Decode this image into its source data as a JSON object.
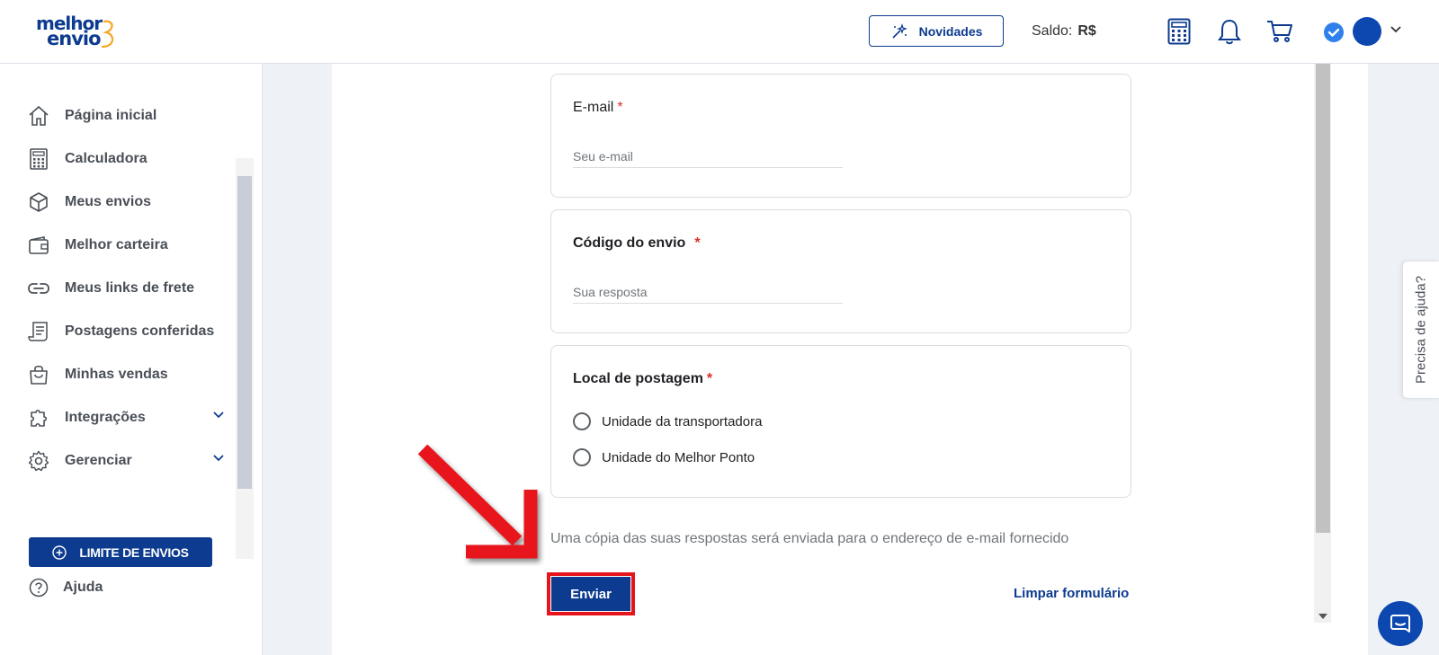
{
  "header": {
    "logo_line1": "melhor",
    "logo_line2": "envio",
    "novidades_label": "Novidades",
    "saldo_label": "Saldo:",
    "saldo_value": "R$"
  },
  "sidebar": {
    "items": [
      {
        "label": "Página inicial",
        "icon": "home-icon"
      },
      {
        "label": "Calculadora",
        "icon": "calculator-icon"
      },
      {
        "label": "Meus envios",
        "icon": "box-icon"
      },
      {
        "label": "Melhor carteira",
        "icon": "wallet-icon"
      },
      {
        "label": "Meus links de frete",
        "icon": "link-icon"
      },
      {
        "label": "Postagens conferidas",
        "icon": "receipt-icon"
      },
      {
        "label": "Minhas vendas",
        "icon": "shopping-bag-icon"
      },
      {
        "label": "Integrações",
        "icon": "puzzle-icon"
      },
      {
        "label": "Gerenciar",
        "icon": "gear-icon"
      }
    ],
    "limite_label": "LIMITE DE ENVIOS",
    "ajuda_label": "Ajuda"
  },
  "form": {
    "email_label": "E-mail",
    "email_placeholder": "Seu e-mail",
    "codigo_label": "Código do envio",
    "codigo_placeholder": "Sua resposta",
    "local_label": "Local de postagem",
    "required_mark": "*",
    "options": [
      "Unidade da transportadora",
      "Unidade do Melhor Ponto"
    ],
    "copy_note": "Uma cópia das suas respostas será enviada para o endereço de e-mail fornecido",
    "submit_label": "Enviar",
    "clear_label": "Limpar formulário"
  },
  "help_tab_label": "Precisa de ajuda?",
  "colors": {
    "brand": "#0c3b8f",
    "annotation": "#e8141b",
    "required": "#d93025"
  }
}
